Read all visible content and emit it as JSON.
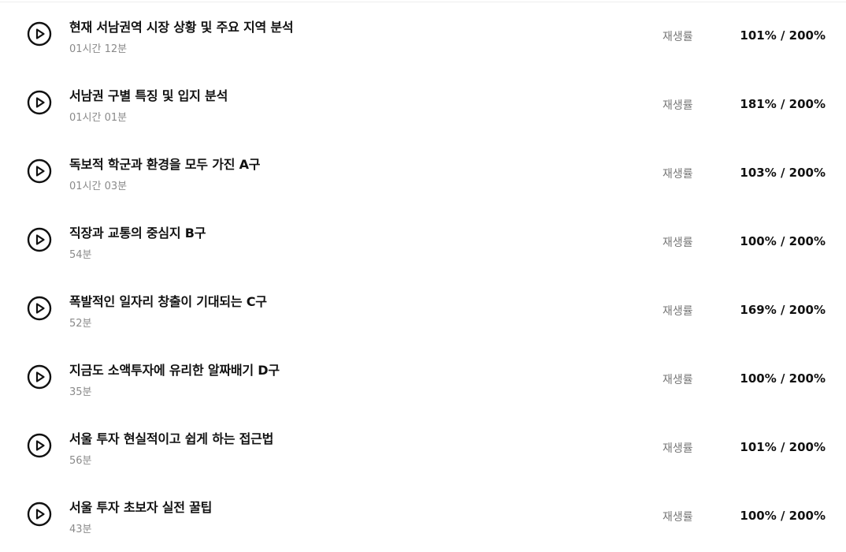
{
  "lectures": [
    {
      "title": "현재 서남권역 시장 상황 및 주요 지역 분석",
      "duration": "01시간 12분",
      "rate_label": "재생률",
      "rate_value": "101% / 200%"
    },
    {
      "title": "서남권 구별 특징 및 입지 분석",
      "duration": "01시간 01분",
      "rate_label": "재생률",
      "rate_value": "181% / 200%"
    },
    {
      "title": "독보적 학군과 환경을 모두 가진 A구",
      "duration": "01시간 03분",
      "rate_label": "재생률",
      "rate_value": "103% / 200%"
    },
    {
      "title": "직장과 교통의 중심지 B구",
      "duration": "54분",
      "rate_label": "재생률",
      "rate_value": "100% / 200%"
    },
    {
      "title": "폭발적인 일자리 창출이 기대되는 C구",
      "duration": "52분",
      "rate_label": "재생률",
      "rate_value": "169% / 200%"
    },
    {
      "title": "지금도 소액투자에 유리한 알짜배기 D구",
      "duration": "35분",
      "rate_label": "재생률",
      "rate_value": "100% / 200%"
    },
    {
      "title": "서울 투자 현실적이고 쉽게 하는 접근법",
      "duration": "56분",
      "rate_label": "재생률",
      "rate_value": "101% / 200%"
    },
    {
      "title": "서울 투자 초보자 실전 꿀팁",
      "duration": "43분",
      "rate_label": "재생률",
      "rate_value": "100% / 200%"
    }
  ],
  "icons": {
    "play": "play-circle-icon"
  },
  "colors": {
    "text": "#111111",
    "muted": "#8a8a8a",
    "label": "#777777"
  }
}
